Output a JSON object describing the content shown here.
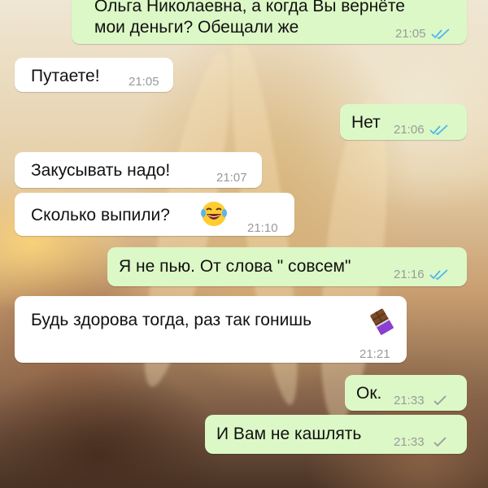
{
  "wallpaper": {
    "description_icon": "photo-wallpaper"
  },
  "colors": {
    "incoming_bubble": "#ffffff",
    "outgoing_bubble": "#dcf8c6",
    "timestamp": "#9a9a9a",
    "read_check": "#4fb6ec",
    "delivered_check": "#9a9a9a"
  },
  "messages": [
    {
      "direction": "out",
      "lines": [
        "Ольга Николаевна, а когда Вы вернёте",
        "мои деньги? Обещали же"
      ],
      "time": "21:05",
      "status": "read"
    },
    {
      "direction": "in",
      "lines": [
        "Путаете!"
      ],
      "time": "21:05"
    },
    {
      "direction": "out",
      "lines": [
        "Нет"
      ],
      "time": "21:06",
      "status": "read"
    },
    {
      "direction": "in",
      "lines": [
        "Закусывать надо!"
      ],
      "time": "21:07"
    },
    {
      "direction": "in",
      "lines": [
        "Сколько выпили?"
      ],
      "emoji": "laughing-with-tears-emoji",
      "time": "21:10"
    },
    {
      "direction": "out",
      "lines": [
        "Я не пью. От слова \" совсем\""
      ],
      "time": "21:16",
      "status": "read"
    },
    {
      "direction": "in",
      "lines": [
        "Будь здорова тогда, раз так гонишь"
      ],
      "emoji": "chocolate-bar-emoji",
      "time": "21:21"
    },
    {
      "direction": "out",
      "lines": [
        "Ок."
      ],
      "time": "21:33",
      "status": "delivered"
    },
    {
      "direction": "out",
      "lines": [
        "И Вам не кашлять"
      ],
      "time": "21:33",
      "status": "delivered"
    }
  ]
}
